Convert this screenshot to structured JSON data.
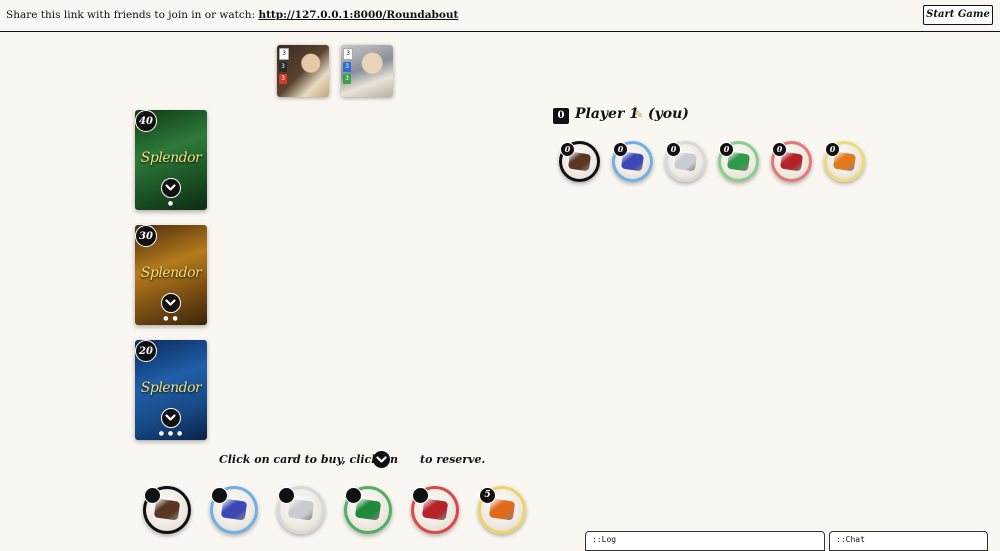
{
  "header": {
    "share_text": "Share this link with friends to join in or watch:",
    "share_link": "http://127.0.0.1:8000/Roundabout",
    "start_button": "Start Game"
  },
  "nobles": [
    {
      "requirements": [
        {
          "color": "#ffffff",
          "count": "3"
        },
        {
          "color": "#2a2a2a",
          "count": "3"
        },
        {
          "color": "#d23a2a",
          "count": "3"
        }
      ]
    },
    {
      "requirements": [
        {
          "color": "#ffffff",
          "count": "3"
        },
        {
          "color": "#2d6fd1",
          "count": "3"
        },
        {
          "color": "#3aa24a",
          "count": "3"
        }
      ]
    }
  ],
  "decks": [
    {
      "tier": 1,
      "remaining": "40",
      "logo": "Splendor",
      "dots": "●",
      "color": "#2e7a3a"
    },
    {
      "tier": 2,
      "remaining": "30",
      "logo": "Splendor",
      "dots": "● ●",
      "color": "#b57a1c"
    },
    {
      "tier": 3,
      "remaining": "20",
      "logo": "Splendor",
      "dots": "● ● ●",
      "color": "#1f5ea8"
    }
  ],
  "player": {
    "index": "0",
    "name": "Player 1",
    "you_label": "(you)",
    "edit_icon": "pencil-icon",
    "tokens": [
      {
        "gem": "onyx",
        "count": "0",
        "ring": "#111111",
        "gem_color": "#5a3623"
      },
      {
        "gem": "sapphire",
        "count": "0",
        "ring": "#6fb0e6",
        "gem_color": "#3b48b5"
      },
      {
        "gem": "diamond",
        "count": "0",
        "ring": "#d9d9d9",
        "gem_color": "#c8cbd0"
      },
      {
        "gem": "emerald",
        "count": "0",
        "ring": "#86cf8a",
        "gem_color": "#2f9a4a"
      },
      {
        "gem": "ruby",
        "count": "0",
        "ring": "#e07a7a",
        "gem_color": "#b5222a"
      },
      {
        "gem": "gold",
        "count": "0",
        "ring": "#eedc7a",
        "gem_color": "#e07a1c"
      }
    ]
  },
  "instruction": {
    "before": "Click on card to buy, click on",
    "after": "to reserve."
  },
  "bank": [
    {
      "gem": "onyx",
      "count": "",
      "ring": "#111111",
      "gem_color": "#5a3623"
    },
    {
      "gem": "sapphire",
      "count": "",
      "ring": "#6fb0e6",
      "gem_color": "#3b48b5"
    },
    {
      "gem": "diamond",
      "count": "",
      "ring": "#d9d9d9",
      "gem_color": "#c8cbd0"
    },
    {
      "gem": "emerald",
      "count": "",
      "ring": "#4fb062",
      "gem_color": "#1f8a3a"
    },
    {
      "gem": "ruby",
      "count": "",
      "ring": "#d84a4a",
      "gem_color": "#b5222a"
    },
    {
      "gem": "gold",
      "count": "5",
      "ring": "#eed36a",
      "gem_color": "#e06a1c"
    }
  ],
  "panels": {
    "log": "::Log",
    "chat": "::Chat"
  }
}
